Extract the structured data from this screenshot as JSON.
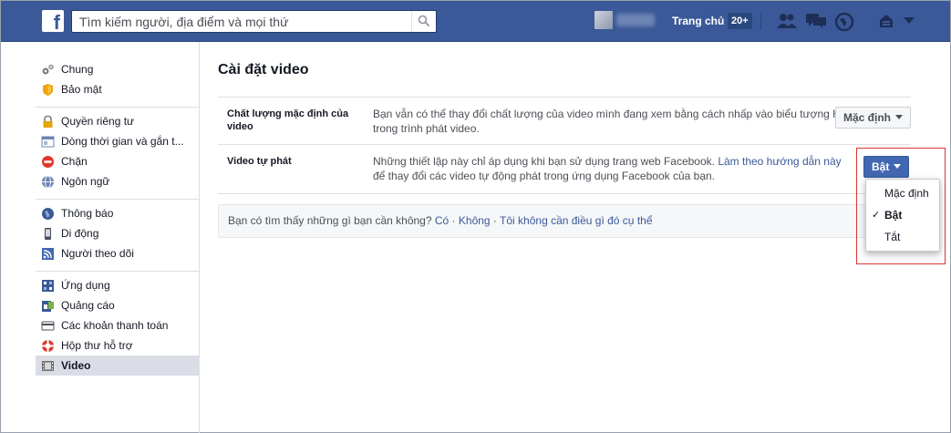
{
  "header": {
    "logo": "f",
    "search_placeholder": "Tìm kiếm người, địa điểm và mọi thứ",
    "home_label": "Trang chủ",
    "home_badge": "20+",
    "brand_color": "#3b5998"
  },
  "sidebar": {
    "groups": [
      [
        {
          "label": "Chung",
          "icon": "gear-icon"
        },
        {
          "label": "Bảo mật",
          "icon": "shield-icon"
        }
      ],
      [
        {
          "label": "Quyền riêng tư",
          "icon": "lock-icon"
        },
        {
          "label": "Dòng thời gian và gắn t...",
          "icon": "timeline-icon"
        },
        {
          "label": "Chặn",
          "icon": "block-icon"
        },
        {
          "label": "Ngôn ngữ",
          "icon": "globe-icon"
        }
      ],
      [
        {
          "label": "Thông báo",
          "icon": "notification-globe-icon"
        },
        {
          "label": "Di động",
          "icon": "mobile-icon"
        },
        {
          "label": "Người theo dõi",
          "icon": "rss-icon"
        }
      ],
      [
        {
          "label": "Ứng dụng",
          "icon": "apps-icon"
        },
        {
          "label": "Quảng cáo",
          "icon": "ads-icon"
        },
        {
          "label": "Các khoản thanh toán",
          "icon": "card-icon"
        },
        {
          "label": "Hộp thư hỗ trợ",
          "icon": "lifebuoy-icon"
        },
        {
          "label": "Video",
          "icon": "film-icon"
        }
      ]
    ],
    "active": "Video"
  },
  "main": {
    "title": "Cài đặt video",
    "rows": [
      {
        "label": "Chất lượng mặc định của video",
        "description": "Bạn vẫn có thể thay đổi chất lượng của video mình đang xem bằng cách nhấp vào biểu tượng HD trong trình phát video.",
        "button": "Mặc định"
      },
      {
        "label": "Video tự phát",
        "description_prefix": "Những thiết lập này chỉ áp dụng khi bạn sử dụng trang web Facebook. ",
        "description_link": "Làm theo hướng dẫn này",
        "description_suffix": " để thay đổi các video tự động phát trong ứng dụng Facebook của bạn.",
        "button": "Bật"
      }
    ],
    "feedback": {
      "question": "Bạn có tìm thấy những gì bạn cần không?",
      "options": [
        "Có",
        "Không",
        "Tôi không cần điều gì đó cụ thể"
      ],
      "separator": " · "
    }
  },
  "dropdown": {
    "options": [
      "Mặc định",
      "Bật",
      "Tắt"
    ],
    "selected": "Bật",
    "check": "✓"
  }
}
